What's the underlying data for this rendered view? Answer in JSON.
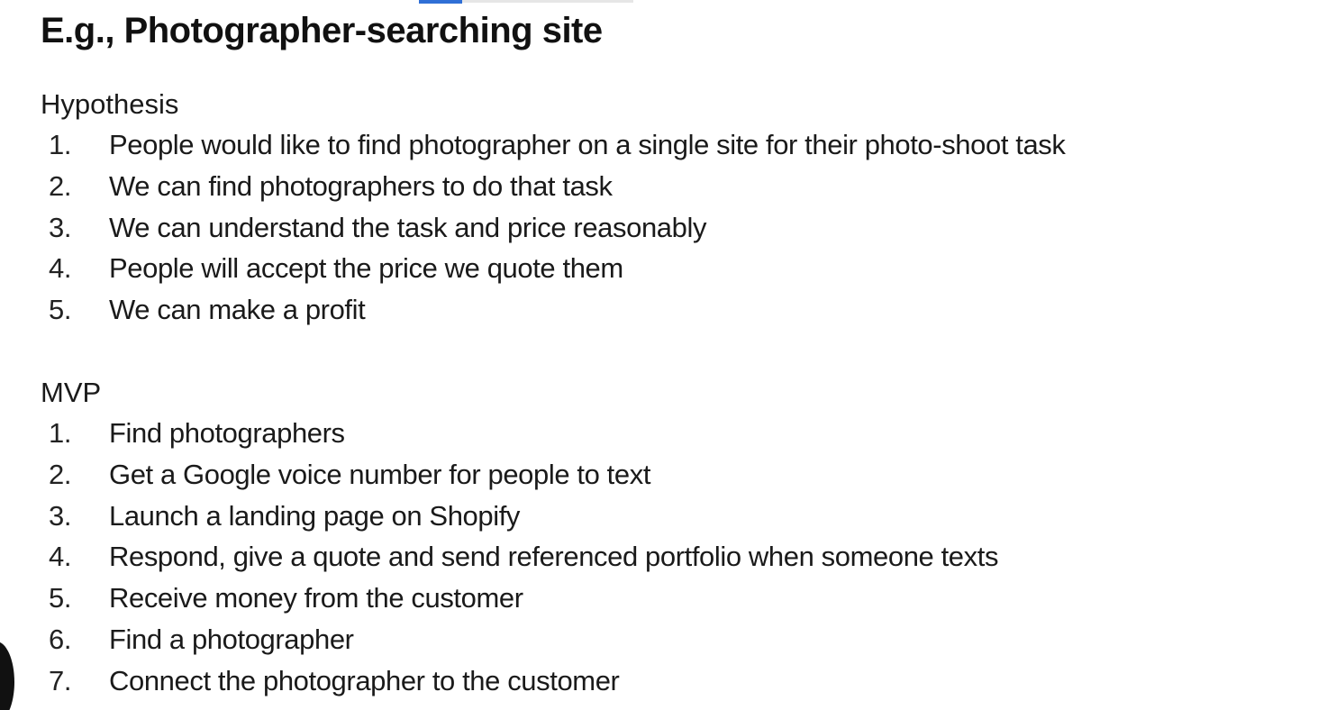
{
  "title": "E.g., Photographer-searching site",
  "hypothesis": {
    "heading": "Hypothesis",
    "items": [
      {
        "num": "1.",
        "text": "People would like to find photographer on a single site for their photo-shoot task"
      },
      {
        "num": "2.",
        "text": "We can find photographers to do that task"
      },
      {
        "num": "3.",
        "text": "We can understand the task and price reasonably"
      },
      {
        "num": "4.",
        "text": "People will accept the price we quote them"
      },
      {
        "num": "5.",
        "text": "We can make a profit"
      }
    ]
  },
  "mvp": {
    "heading": "MVP",
    "items": [
      {
        "num": "1.",
        "text": "Find photographers"
      },
      {
        "num": "2.",
        "text": "Get a Google voice number for people to text"
      },
      {
        "num": "3.",
        "text": "Launch a landing page on Shopify"
      },
      {
        "num": "4.",
        "text": "Respond, give a quote and send referenced portfolio when someone texts"
      },
      {
        "num": "5.",
        "text": "Receive money from the customer"
      },
      {
        "num": "6.",
        "text": "Find a photographer"
      },
      {
        "num": "7.",
        "text": "Connect the photographer to the customer"
      }
    ]
  },
  "colors": {
    "accent": "#2f6fd6",
    "text": "#1a1a1a",
    "background": "#ffffff"
  }
}
